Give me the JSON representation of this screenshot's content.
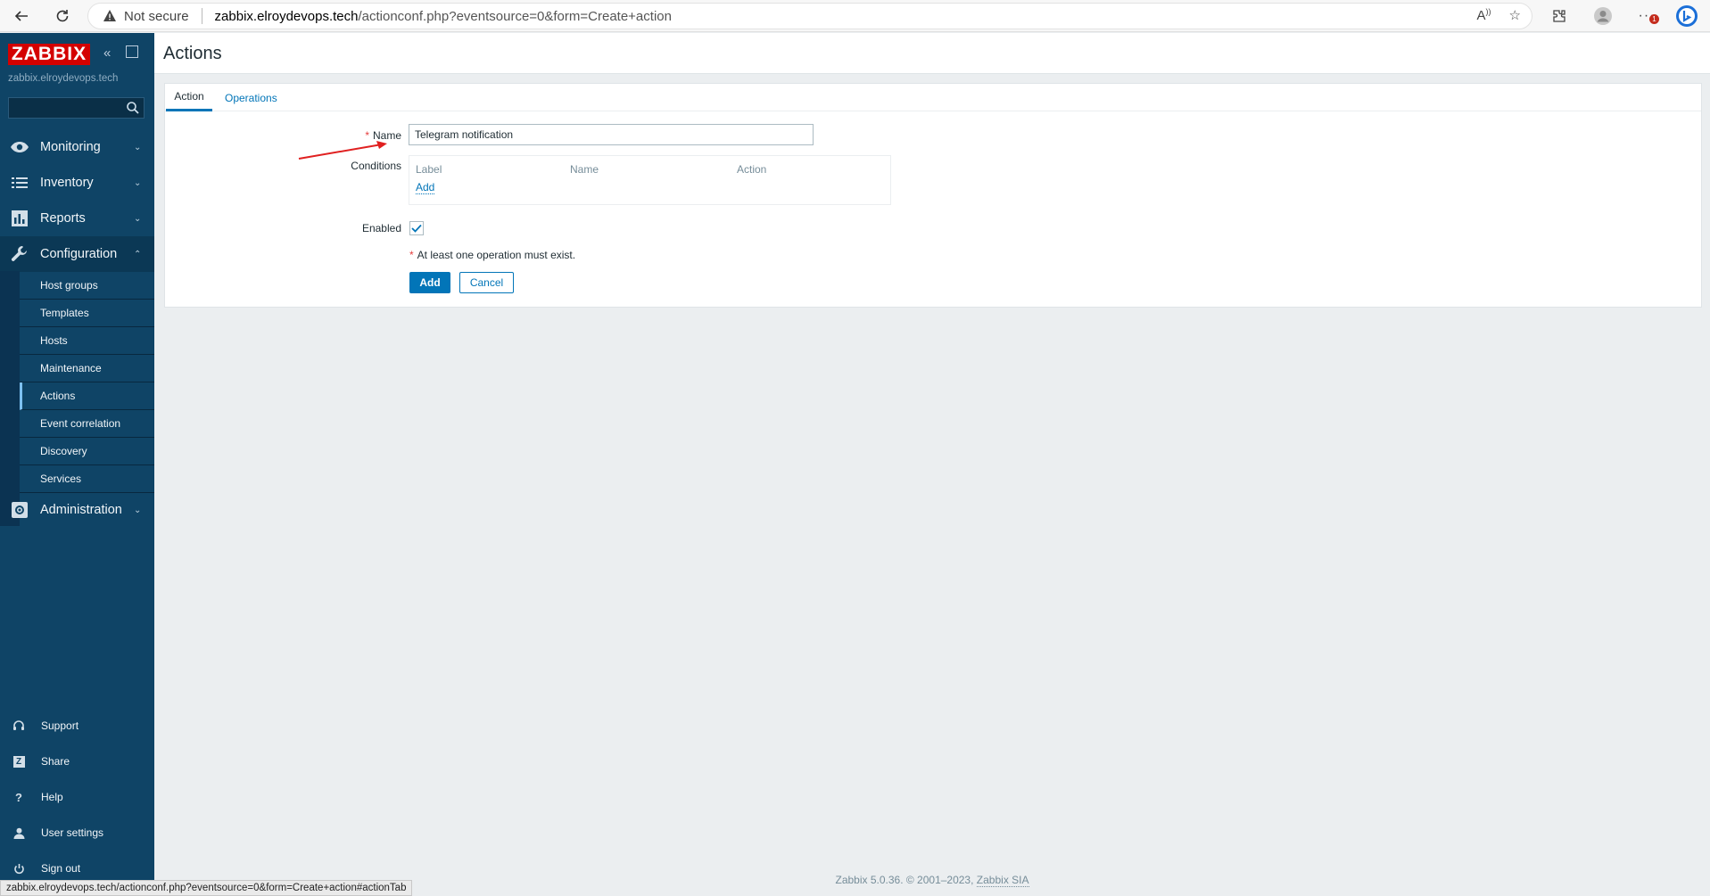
{
  "browser": {
    "security_label": "Not secure",
    "url_host": "zabbix.elroydevops.tech",
    "url_path": "/actionconf.php?eventsource=0&form=Create+action",
    "notification_badge": "1",
    "status_url": "zabbix.elroydevops.tech/actionconf.php?eventsource=0&form=Create+action#actionTab"
  },
  "sidebar": {
    "logo": "ZABBIX",
    "server_name": "zabbix.elroydevops.tech",
    "search_placeholder": "",
    "menu": [
      {
        "label": "Monitoring",
        "icon": "eye-icon"
      },
      {
        "label": "Inventory",
        "icon": "list-icon"
      },
      {
        "label": "Reports",
        "icon": "bar-chart-icon"
      },
      {
        "label": "Configuration",
        "icon": "wrench-icon"
      },
      {
        "label": "Administration",
        "icon": "cog-icon"
      }
    ],
    "config_submenu": [
      "Host groups",
      "Templates",
      "Hosts",
      "Maintenance",
      "Actions",
      "Event correlation",
      "Discovery",
      "Services"
    ],
    "bottom": [
      {
        "label": "Support",
        "icon": "headset-icon"
      },
      {
        "label": "Share",
        "icon": "share-icon"
      },
      {
        "label": "Help",
        "icon": "help-icon"
      },
      {
        "label": "User settings",
        "icon": "user-icon"
      },
      {
        "label": "Sign out",
        "icon": "power-icon"
      }
    ]
  },
  "page": {
    "title": "Actions",
    "tabs": [
      {
        "label": "Action"
      },
      {
        "label": "Operations"
      }
    ],
    "form": {
      "name_label": "Name",
      "name_value": "Telegram notification",
      "conditions_label": "Conditions",
      "conditions_headers": [
        "Label",
        "Name",
        "Action"
      ],
      "conditions_add": "Add",
      "enabled_label": "Enabled",
      "enabled": true,
      "note": "At least one operation must exist.",
      "add_button": "Add",
      "cancel_button": "Cancel"
    }
  },
  "footer": {
    "text": "Zabbix 5.0.36. © 2001–2023,",
    "link": "Zabbix SIA"
  }
}
